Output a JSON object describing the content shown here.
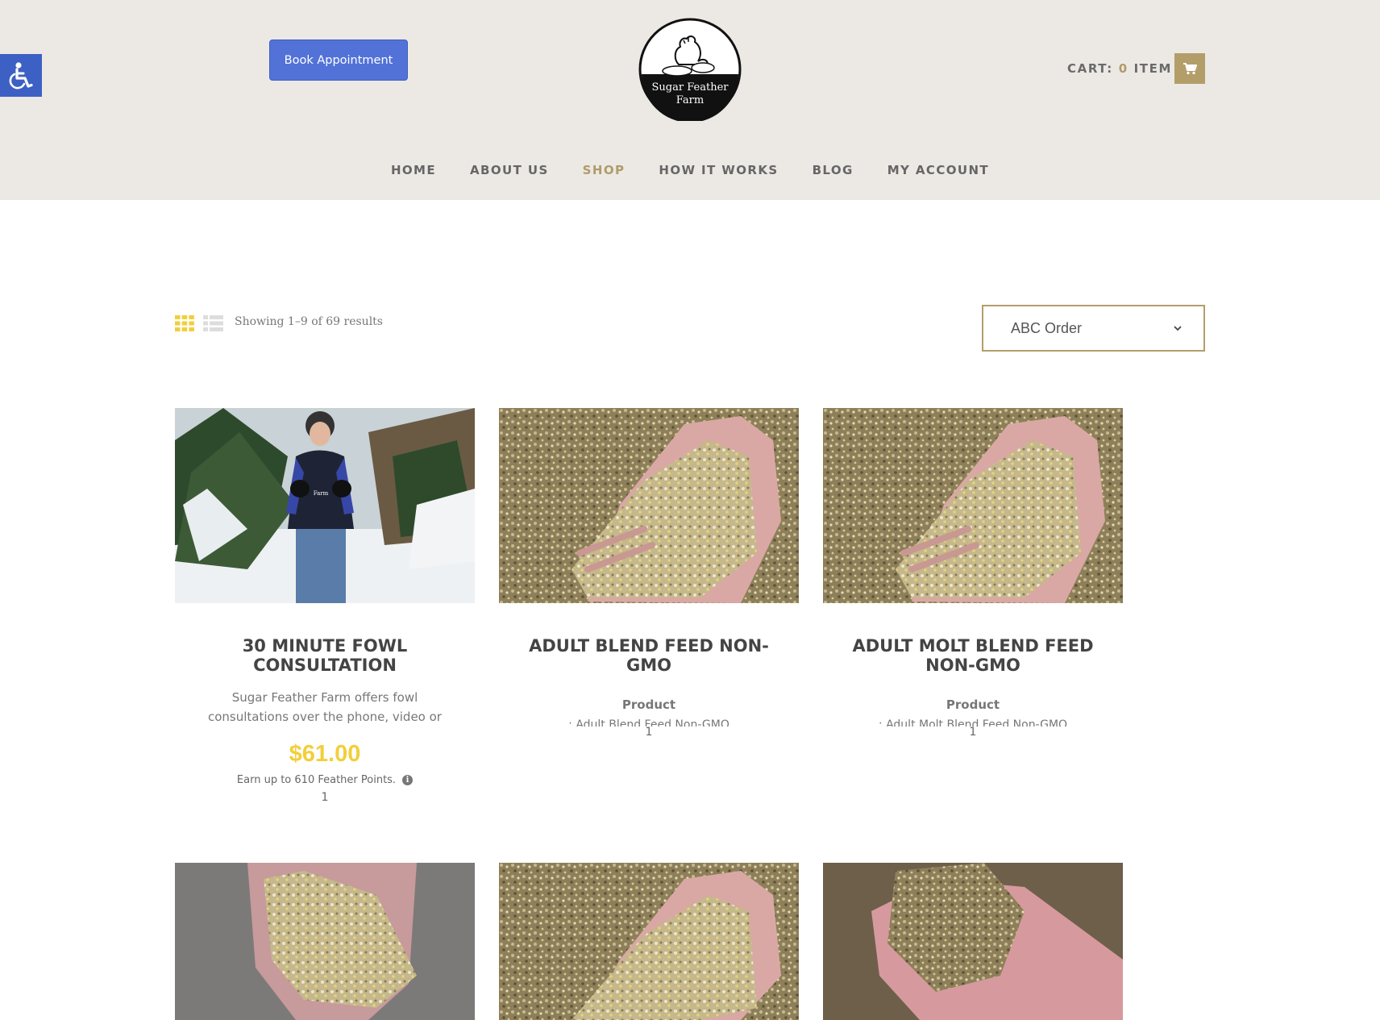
{
  "header": {
    "book_label": "Book Appointment",
    "logo_line1": "Sugar Feather",
    "logo_line2": "Farm",
    "cart_prefix": "CART: ",
    "cart_count": "0",
    "cart_suffix": " ITEM"
  },
  "nav": {
    "items": [
      "HOME",
      "ABOUT US",
      "SHOP",
      "HOW IT WORKS",
      "BLOG",
      "MY ACCOUNT"
    ],
    "active": "SHOP"
  },
  "toolbar": {
    "results": "Showing 1–9 of 69 results",
    "sort_value": "ABC Order"
  },
  "products": [
    {
      "title": "30 MINUTE FOWL CONSULTATION",
      "desc": "Sugar Feather Farm offers fowl consultations over the phone, video or",
      "price": "$61.00",
      "points": "Earn up to 610 Feather Points.",
      "qty": "1"
    },
    {
      "title": "ADULT BLEND FEED NON-GMO",
      "label": "Product",
      "sub": ": Adult Blend Feed Non-GMO",
      "qty": "1"
    },
    {
      "title": "ADULT MOLT BLEND FEED NON-GMO",
      "label": "Product",
      "sub": ": Adult Molt Blend Feed Non-GMO",
      "qty": "1"
    }
  ],
  "colors": {
    "header_bg": "#ece9e5",
    "accent_gold": "#b39e6a",
    "price_yellow": "#f2cf3a",
    "book_blue": "#5272d8",
    "access_blue": "#3d60c4"
  },
  "icons": [
    "accessibility-icon",
    "cart-icon",
    "grid-view-icon",
    "list-view-icon",
    "chevron-down-icon",
    "info-icon"
  ]
}
